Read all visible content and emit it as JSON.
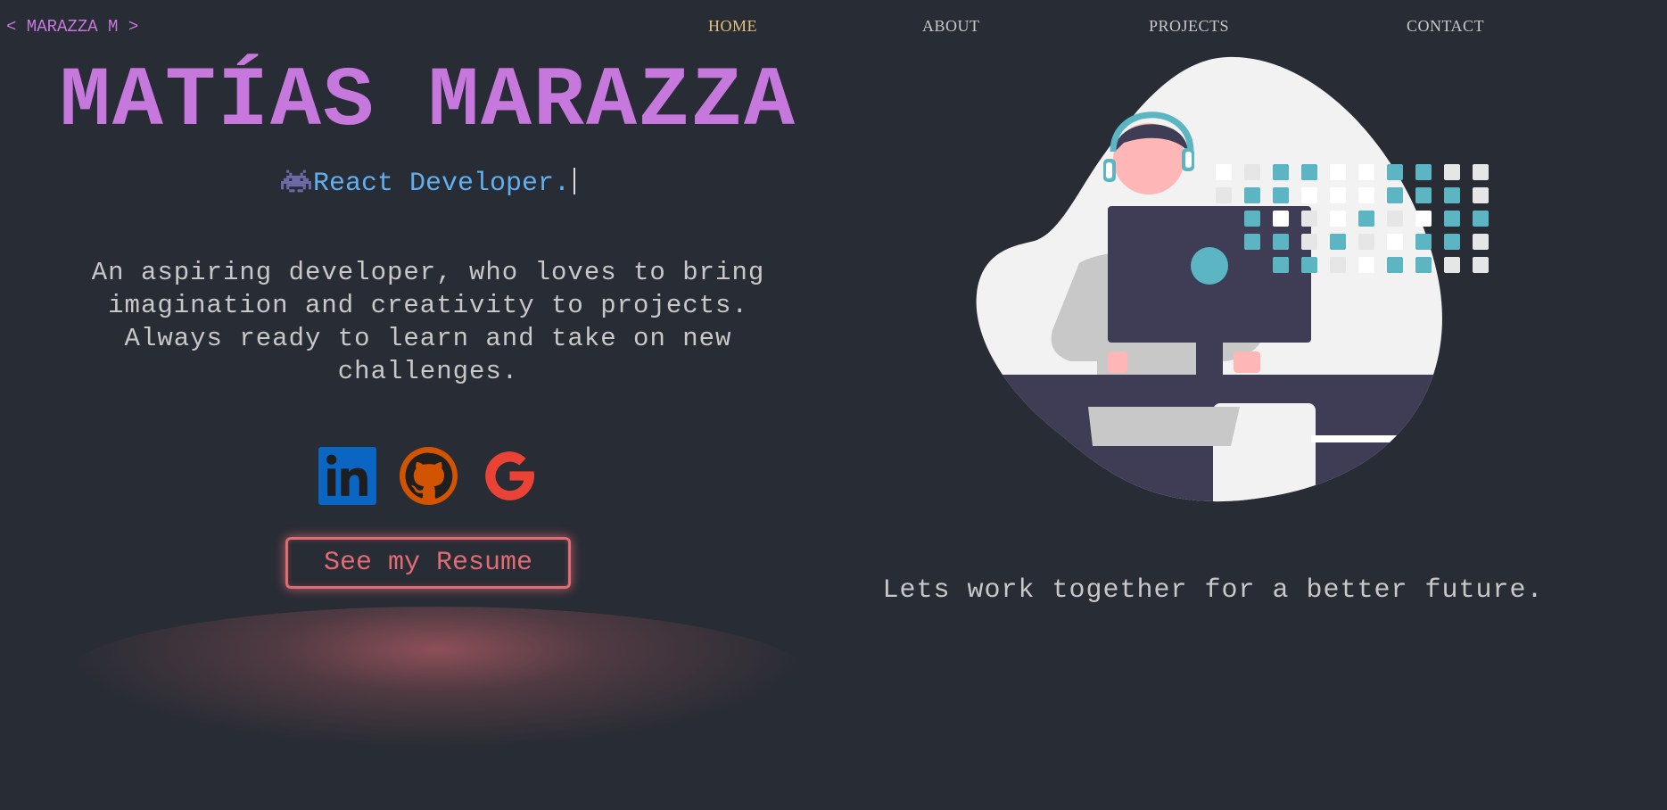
{
  "header": {
    "logo": "< MARAZZA M >",
    "nav": [
      {
        "label": "HOME",
        "active": true
      },
      {
        "label": "ABOUT",
        "active": false
      },
      {
        "label": "PROJECTS",
        "active": false
      },
      {
        "label": "CONTACT",
        "active": false
      }
    ]
  },
  "hero": {
    "name": "MATÍAS MARAZZA",
    "role": "React Developer.",
    "role_icon": "space-invader-icon",
    "bio": "An aspiring developer, who loves to bring imagination and creativity to projects. Always ready to learn and take on new challenges.",
    "social": [
      {
        "name": "linkedin-icon",
        "color": "#0a66c2"
      },
      {
        "name": "github-icon",
        "color": "#d35400"
      },
      {
        "name": "google-icon",
        "color": "#ea4335"
      }
    ],
    "resume_button": "See my Resume"
  },
  "illustration": {
    "name": "developer-illustration"
  },
  "tagline": "Lets work together for a better future.",
  "colors": {
    "background": "#282c34",
    "accent_purple": "#c678dd",
    "accent_blue": "#61afef",
    "accent_red": "#e06c75",
    "active_nav": "#e5c07b",
    "text": "#c8c8c8",
    "teal": "#5bb5c3"
  }
}
